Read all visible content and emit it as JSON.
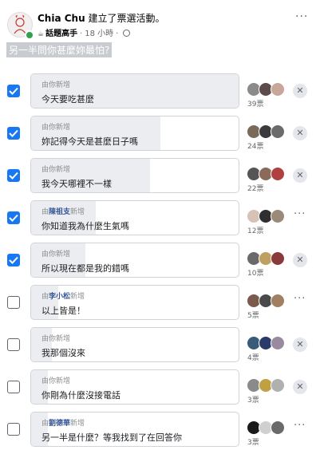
{
  "post": {
    "author": "Chia Chu",
    "action": "建立了票選活動。",
    "badge_label": "話題高手",
    "time": "18 小時",
    "question": "另一半問你甚麼妳最怕?"
  },
  "options": [
    {
      "checked": true,
      "added_prefix": "由你新增",
      "adder": "",
      "added_suffix": "",
      "text": "今天要吃甚麼",
      "votes": "39票",
      "fill": 1.0,
      "action": "remove",
      "voter_colors": [
        "#8a8a8a",
        "#5d4a4a",
        "#c9a69a"
      ]
    },
    {
      "checked": true,
      "added_prefix": "由你新增",
      "adder": "",
      "added_suffix": "",
      "text": "妳記得今天是甚麼日子嗎",
      "votes": "24票",
      "fill": 0.62,
      "action": "remove",
      "voter_colors": [
        "#7a6a5a",
        "#3b3b3b",
        "#6b6b6b"
      ]
    },
    {
      "checked": true,
      "added_prefix": "由你新增",
      "adder": "",
      "added_suffix": "",
      "text": "我今天哪裡不一樣",
      "votes": "22票",
      "fill": 0.57,
      "action": "remove",
      "voter_colors": [
        "#555555",
        "#8c6a5a",
        "#b04040"
      ]
    },
    {
      "checked": true,
      "added_prefix": "由",
      "adder": "陳祖支",
      "added_suffix": "新增",
      "text": "你知道我為什麼生氣嗎",
      "votes": "12票",
      "fill": 0.31,
      "action": "more",
      "voter_colors": [
        "#d7c3b5",
        "#2f2f2f",
        "#9a8a7a"
      ]
    },
    {
      "checked": true,
      "added_prefix": "由你新增",
      "adder": "",
      "added_suffix": "",
      "text": "所以現在都是我的錯嗎",
      "votes": "10票",
      "fill": 0.26,
      "action": "remove",
      "voter_colors": [
        "#6a6a6a",
        "#c0a060",
        "#8a3a3a"
      ]
    },
    {
      "checked": false,
      "added_prefix": "由",
      "adder": "李小松",
      "added_suffix": "新增",
      "text": "以上皆是！",
      "votes": "5票",
      "fill": 0.13,
      "action": "more",
      "voter_colors": [
        "#7a5a4a",
        "#4a4a4a",
        "#a08060"
      ]
    },
    {
      "checked": false,
      "added_prefix": "由你新增",
      "adder": "",
      "added_suffix": "",
      "text": "我那個沒來",
      "votes": "4票",
      "fill": 0.1,
      "action": "remove",
      "voter_colors": [
        "#3a5a7a",
        "#2a3a6a",
        "#9a8aa0"
      ]
    },
    {
      "checked": false,
      "added_prefix": "由你新增",
      "adder": "",
      "added_suffix": "",
      "text": "你剛為什麼沒接電話",
      "votes": "3票",
      "fill": 0.08,
      "action": "remove",
      "voter_colors": [
        "#8a8a8a",
        "#c0a040",
        "#b0b0b0"
      ]
    },
    {
      "checked": false,
      "added_prefix": "由",
      "adder": "劉德華",
      "added_suffix": "新增",
      "text": "另一半是什麼？等我找到了在回答你",
      "votes": "3票",
      "fill": 0.08,
      "action": "more",
      "voter_colors": [
        "#1a1a1a",
        "#d0d0d0",
        "#6a6a6a"
      ]
    }
  ]
}
